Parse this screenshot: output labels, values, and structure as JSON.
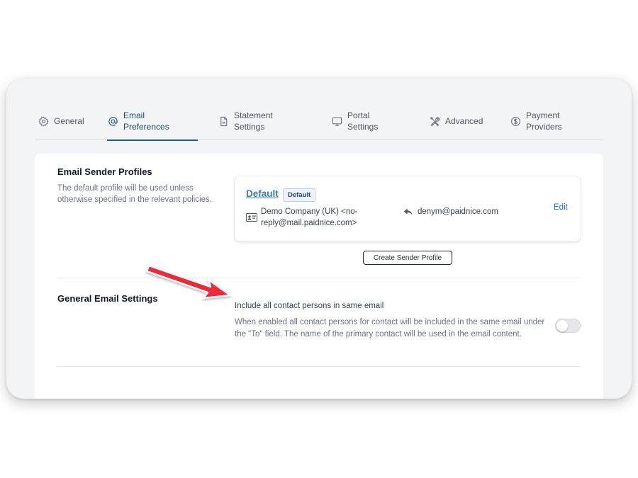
{
  "colors": {
    "accent": "#1f5f86",
    "link": "#2563eb",
    "annotation_arrow": "#ee2c37"
  },
  "tabs": [
    {
      "label": "General",
      "icon": "gear-icon",
      "active": false
    },
    {
      "label": "Email Preferences",
      "icon": "at-sign-icon",
      "active": true
    },
    {
      "label": "Statement Settings",
      "icon": "document-icon",
      "active": false
    },
    {
      "label": "Portal Settings",
      "icon": "monitor-icon",
      "active": false
    },
    {
      "label": "Advanced",
      "icon": "tools-icon",
      "active": false
    },
    {
      "label": "Payment Providers",
      "icon": "dollar-circle-icon",
      "active": false
    }
  ],
  "sender_profiles": {
    "title": "Email Sender Profiles",
    "description": "The default profile will be used unless otherwise specified in the relevant policies.",
    "profile": {
      "name": "Default",
      "badge": "Default",
      "sender": "Demo Company (UK) <no-reply@mail.paidnice.com>",
      "reply_to": "denym@paidnice.com",
      "edit_label": "Edit"
    },
    "create_button": "Create Sender Profile"
  },
  "general_settings": {
    "title": "General Email Settings",
    "setting_title": "Include all contact persons in same email",
    "setting_description": "When enabled all contact persons for contact will be included in the same email under the \"To\" field. The name of the primary contact will be used in the email content.",
    "toggle_on": false
  }
}
